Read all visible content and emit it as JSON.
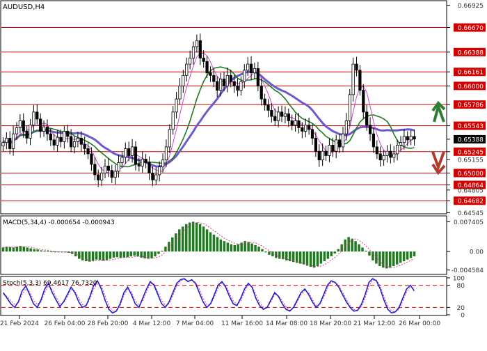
{
  "chart_data": [
    {
      "type": "candlestick",
      "title": "AUDUSD,H4",
      "x_tick_labels": [
        "21 Feb 2024",
        "26 Feb 04:00",
        "28 Feb 20:00",
        "4 Mar 12:00",
        "7 Mar 04:00",
        "11 Mar 16:00",
        "14 Mar 08:00",
        "18 Mar 20:00",
        "21 Mar 12:00",
        "26 Mar 00:00"
      ],
      "ylim": [
        0.6454,
        0.6697
      ],
      "y_tick_labels": [
        "0.66925",
        "0.66670",
        "0.66388",
        "0.66161",
        "0.66000",
        "0.65786",
        "0.65543",
        "0.65388",
        "0.65155",
        "0.65245",
        "0.65000",
        "0.64864",
        "0.64805",
        "0.64682",
        "0.64545"
      ],
      "horizontal_levels": [
        0.6667,
        0.66388,
        0.66161,
        0.66,
        0.65786,
        0.65543,
        0.65245,
        0.65,
        0.64864,
        0.64682
      ],
      "level_color": "#d40000",
      "last_price": 0.65388,
      "last_price_label": "0.65388",
      "candles_close": [
        0.6535,
        0.654,
        0.6528,
        0.6545,
        0.6552,
        0.656,
        0.6548,
        0.654,
        0.6555,
        0.657,
        0.6562,
        0.6548,
        0.6553,
        0.6545,
        0.6538,
        0.6532,
        0.6541,
        0.6536,
        0.6548,
        0.6542,
        0.653,
        0.6536,
        0.654,
        0.6533,
        0.6528,
        0.6522,
        0.651,
        0.6498,
        0.6492,
        0.65,
        0.6508,
        0.6503,
        0.6495,
        0.6502,
        0.6512,
        0.6518,
        0.6528,
        0.652,
        0.653,
        0.651,
        0.6508,
        0.6516,
        0.6512,
        0.65,
        0.6492,
        0.6498,
        0.6507,
        0.6515,
        0.653,
        0.655,
        0.657,
        0.6585,
        0.66,
        0.6612,
        0.6625,
        0.6632,
        0.6645,
        0.6652,
        0.6632,
        0.6628,
        0.6615,
        0.6612,
        0.6605,
        0.6595,
        0.6608,
        0.66,
        0.6612,
        0.6605,
        0.66,
        0.6595,
        0.6605,
        0.6618,
        0.6625,
        0.6615,
        0.662,
        0.66,
        0.6585,
        0.6578,
        0.6572,
        0.6565,
        0.656,
        0.657,
        0.6565,
        0.6568,
        0.656,
        0.6555,
        0.656,
        0.6552,
        0.6548,
        0.6555,
        0.655,
        0.654,
        0.6525,
        0.6515,
        0.6525,
        0.652,
        0.6532,
        0.6525,
        0.6538,
        0.653,
        0.6545,
        0.656,
        0.659,
        0.6625,
        0.6618,
        0.6595,
        0.657,
        0.6555,
        0.6545,
        0.653,
        0.6522,
        0.6515,
        0.652,
        0.6525,
        0.6518,
        0.6522,
        0.6532,
        0.6535,
        0.6542,
        0.6538,
        0.6542,
        0.6539
      ],
      "indicators": {
        "ma_colors": [
          "#6a5acd",
          "#1f7a1f",
          "#cc44cc"
        ],
        "arrow_up_color": "#2e7d32",
        "arrow_down_color": "#b03a2e"
      }
    },
    {
      "type": "bar",
      "title": "MACD(5,34,4) -0.000654 -0.000943",
      "ylim": [
        -0.0055,
        0.0085
      ],
      "y_tick_labels": [
        "0.007405",
        "0.00",
        "-0.004584"
      ],
      "histogram": [
        0.001,
        0.0012,
        0.0011,
        0.001,
        0.0012,
        0.0014,
        0.0012,
        0.001,
        0.0008,
        0.0006,
        0.0005,
        0.0003,
        0.0002,
        0.0001,
        -0.0001,
        -0.0002,
        -0.0001,
        -0.0002,
        -0.0001,
        -0.0003,
        -0.0006,
        -0.0012,
        -0.0018,
        -0.0022,
        -0.0024,
        -0.0025,
        -0.0023,
        -0.002,
        -0.0021,
        -0.0023,
        -0.0022,
        -0.0018,
        -0.0015,
        -0.0014,
        -0.0016,
        -0.0015,
        -0.0014,
        -0.0012,
        -0.001,
        -0.0012,
        -0.0015,
        -0.0017,
        -0.0018,
        -0.0017,
        -0.0012,
        -0.0006,
        0.0002,
        0.0012,
        0.0024,
        0.0035,
        0.0045,
        0.0055,
        0.0062,
        0.0068,
        0.0072,
        0.0074,
        0.0072,
        0.0068,
        0.0062,
        0.0055,
        0.0048,
        0.0042,
        0.0036,
        0.003,
        0.0026,
        0.0022,
        0.0018,
        0.0016,
        0.0018,
        0.0022,
        0.0026,
        0.0024,
        0.002,
        0.0016,
        0.0012,
        0.0006,
        -0.0002,
        -0.0008,
        -0.0012,
        -0.0016,
        -0.0018,
        -0.0019,
        -0.0022,
        -0.0024,
        -0.0026,
        -0.0028,
        -0.003,
        -0.0032,
        -0.0035,
        -0.0038,
        -0.004,
        -0.0036,
        -0.003,
        -0.0024,
        -0.0018,
        -0.0012,
        -0.0005,
        0.0006,
        0.0018,
        0.003,
        0.0036,
        0.0032,
        0.0026,
        0.0018,
        0.001,
        0.0002,
        -0.001,
        -0.0022,
        -0.003,
        -0.0036,
        -0.004,
        -0.0042,
        -0.004,
        -0.0036,
        -0.0032,
        -0.0028,
        -0.0024,
        -0.002,
        -0.0016,
        -0.0012
      ],
      "bar_color": "#1e7b1e",
      "negative_bar_color": "#1e7b1e",
      "signal_color": "#d63384"
    },
    {
      "type": "line",
      "title": "Stoch(5,3,3) 69.4617 76.7320",
      "ylim": [
        0,
        100
      ],
      "y_tick_labels": [
        "100",
        "80",
        "20",
        "0"
      ],
      "levels": [
        80,
        20
      ],
      "main_line": [
        60,
        45,
        30,
        20,
        35,
        65,
        78,
        55,
        30,
        20,
        40,
        70,
        85,
        60,
        40,
        22,
        35,
        55,
        75,
        60,
        35,
        20,
        25,
        50,
        80,
        92,
        70,
        40,
        15,
        5,
        10,
        30,
        60,
        75,
        55,
        30,
        20,
        45,
        70,
        90,
        80,
        55,
        30,
        20,
        35,
        60,
        85,
        95,
        98,
        90,
        95,
        85,
        60,
        35,
        20,
        30,
        55,
        80,
        90,
        75,
        50,
        30,
        25,
        45,
        70,
        85,
        75,
        45,
        25,
        15,
        20,
        40,
        60,
        50,
        30,
        15,
        10,
        20,
        40,
        60,
        70,
        55,
        35,
        20,
        30,
        55,
        80,
        92,
        88,
        75,
        55,
        35,
        20,
        10,
        12,
        28,
        55,
        88,
        98,
        92,
        70,
        40,
        15,
        5,
        8,
        20,
        45,
        70,
        80,
        65
      ],
      "signal_line": [
        55,
        50,
        38,
        28,
        32,
        55,
        70,
        62,
        40,
        28,
        35,
        60,
        78,
        68,
        48,
        30,
        32,
        48,
        68,
        65,
        45,
        28,
        25,
        42,
        70,
        85,
        78,
        52,
        25,
        10,
        10,
        25,
        52,
        70,
        62,
        40,
        25,
        38,
        62,
        85,
        83,
        62,
        40,
        25,
        30,
        52,
        78,
        92,
        96,
        92,
        93,
        88,
        70,
        45,
        28,
        28,
        48,
        72,
        86,
        80,
        58,
        38,
        28,
        38,
        62,
        80,
        78,
        55,
        32,
        20,
        20,
        35,
        55,
        52,
        38,
        22,
        12,
        18,
        35,
        55,
        66,
        60,
        42,
        25,
        28,
        48,
        72,
        88,
        89,
        80,
        62,
        42,
        25,
        15,
        12,
        22,
        45,
        78,
        94,
        94,
        78,
        50,
        25,
        10,
        8,
        15,
        38,
        62,
        76,
        72
      ],
      "main_color": "#1e1ecc",
      "signal_color": "#d63384",
      "level_color": "#d40000"
    }
  ]
}
